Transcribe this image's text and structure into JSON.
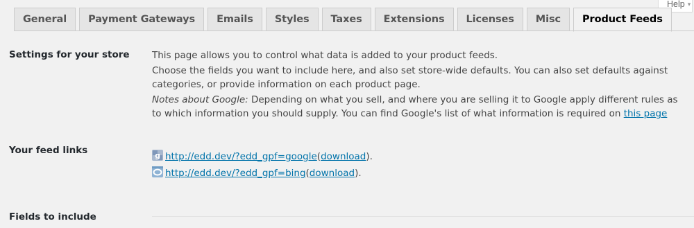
{
  "help": {
    "label": "Help",
    "caret": "▾"
  },
  "tabs": [
    {
      "label": "General",
      "active": false
    },
    {
      "label": "Payment Gateways",
      "active": false
    },
    {
      "label": "Emails",
      "active": false
    },
    {
      "label": "Styles",
      "active": false
    },
    {
      "label": "Taxes",
      "active": false
    },
    {
      "label": "Extensions",
      "active": false
    },
    {
      "label": "Licenses",
      "active": false
    },
    {
      "label": "Misc",
      "active": false
    },
    {
      "label": "Product Feeds",
      "active": true
    }
  ],
  "settings": {
    "label": "Settings for your store",
    "intro": "This page allows you to control what data is added to your product feeds.",
    "choose": "Choose the fields you want to include here, and also set store-wide defaults. You can also set defaults against categories, or provide information on each product page.",
    "google_note_label": "Notes about Google:",
    "google_note_text": " Depending on what you sell, and where you are selling it to Google apply different rules as to which information you should supply. You can find Google's list of what information is required on ",
    "google_note_link": "this page"
  },
  "feed_links": {
    "label": "Your feed links",
    "items": [
      {
        "icon": "google-icon",
        "url": "http://edd.dev/?edd_gpf=google",
        "download_label": "download",
        "before": " (",
        "after": ")."
      },
      {
        "icon": "bing-icon",
        "url": "http://edd.dev/?edd_gpf=bing",
        "download_label": "download",
        "before": " (",
        "after": ")."
      }
    ]
  },
  "fields": {
    "label": "Fields to include"
  },
  "colors": {
    "link": "#0073aa",
    "background": "#f1f1f1",
    "tab_background": "#e5e5e5"
  }
}
